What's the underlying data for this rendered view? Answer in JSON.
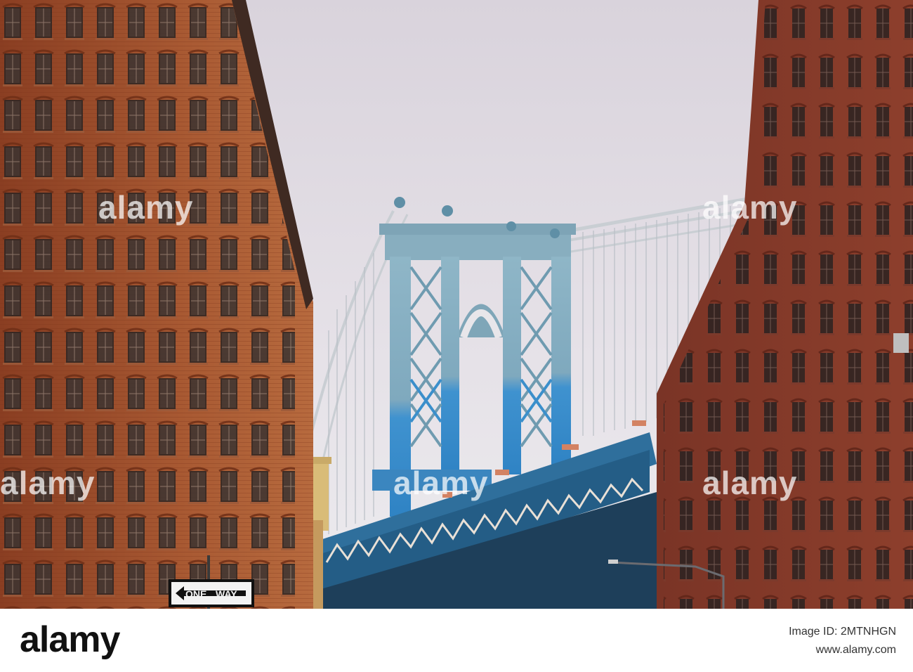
{
  "photo": {
    "subject": "bridge tower between brick buildings",
    "sign": {
      "word_1": "ONE",
      "word_2": "WAY"
    }
  },
  "watermark": {
    "text": "alamy"
  },
  "footer": {
    "logo": "alamy",
    "image_id_line": "Image ID: 2MTNHGN",
    "site_line": "www.alamy.com"
  }
}
